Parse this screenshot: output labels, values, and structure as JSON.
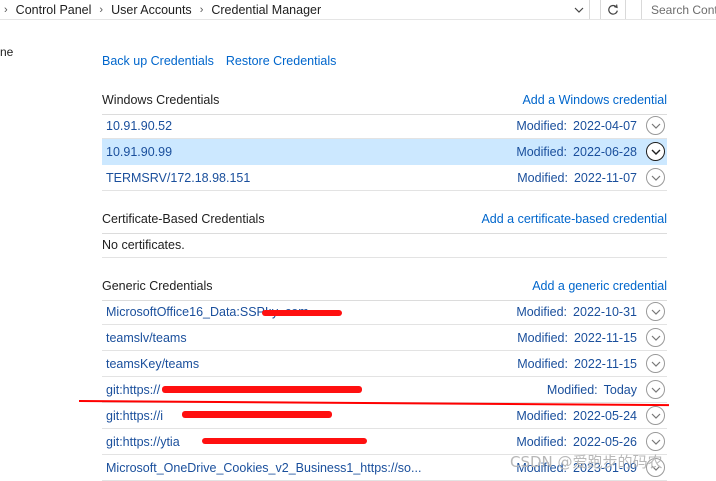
{
  "breadcrumb": {
    "items": [
      "Control Panel",
      "User Accounts",
      "Credential Manager"
    ]
  },
  "search": {
    "placeholder": "Search Cont"
  },
  "left_fragment": "ne",
  "actions": {
    "backup": "Back up Credentials",
    "restore": "Restore Credentials"
  },
  "windows": {
    "title": "Windows Credentials",
    "add": "Add a Windows credential",
    "items": [
      {
        "name": "10.91.90.52",
        "modified_label": "Modified:",
        "date": "2022-04-07"
      },
      {
        "name": "10.91.90.99",
        "modified_label": "Modified:",
        "date": "2022-06-28",
        "selected": true
      },
      {
        "name": "TERMSRV/172.18.98.151",
        "modified_label": "Modified:",
        "date": "2022-11-07"
      }
    ]
  },
  "certificate": {
    "title": "Certificate-Based Credentials",
    "add": "Add a certificate-based credential",
    "empty": "No certificates."
  },
  "generic": {
    "title": "Generic Credentials",
    "add": "Add a generic credential",
    "items": [
      {
        "name": "MicrosoftOffice16_Data:SSPI:y                       .com",
        "modified_label": "Modified:",
        "date": "2022-10-31"
      },
      {
        "name": "teamslv/teams",
        "modified_label": "Modified:",
        "date": "2022-11-15"
      },
      {
        "name": "teamsKey/teams",
        "modified_label": "Modified:",
        "date": "2022-11-15"
      },
      {
        "name": "git:https://",
        "modified_label": "Modified:",
        "date": "Today"
      },
      {
        "name": "git:https://i",
        "modified_label": "Modified:",
        "date": "2022-05-24"
      },
      {
        "name": "git:https://ytia",
        "modified_label": "Modified:",
        "date": "2022-05-26"
      },
      {
        "name": "Microsoft_OneDrive_Cookies_v2_Business1_https://so...",
        "modified_label": "Modified:",
        "date": "2023-01-09"
      }
    ]
  },
  "watermark": "CSDN @爱跑步的码农",
  "icons": {
    "breadcrumb_separator": "chevron-right-icon",
    "address_dropdown": "chevron-down-icon",
    "refresh": "refresh-icon",
    "expand": "expand-circle-chevron-icon"
  },
  "colors": {
    "link": "#0066cc",
    "selected_row": "#cce8ff",
    "redaction": "#ff1010"
  }
}
